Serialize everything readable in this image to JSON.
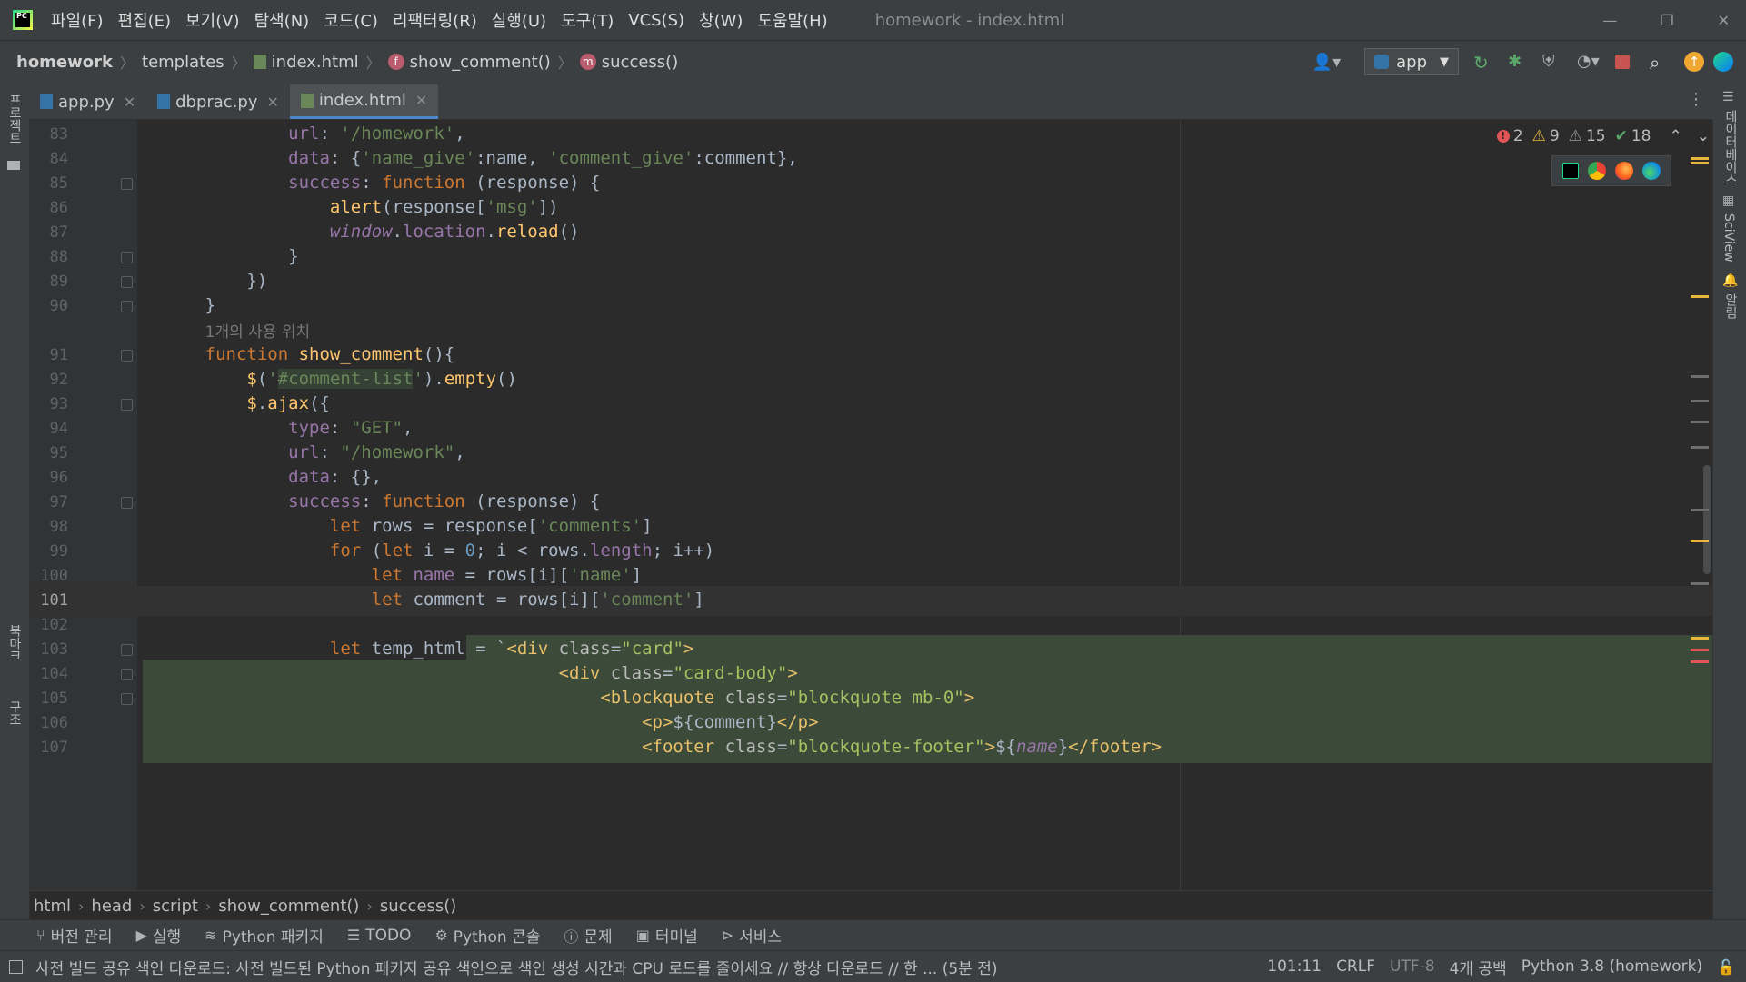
{
  "window": {
    "title": "homework - index.html"
  },
  "menu": [
    "파일(F)",
    "편집(E)",
    "보기(V)",
    "탐색(N)",
    "코드(C)",
    "리팩터링(R)",
    "실행(U)",
    "도구(T)",
    "VCS(S)",
    "창(W)",
    "도움말(H)"
  ],
  "breadcrumb": {
    "project": "homework",
    "folder": "templates",
    "file": "index.html",
    "func": "show_comment()",
    "method": "success()"
  },
  "run_config": "app",
  "tabs": [
    {
      "label": "app.py",
      "active": false
    },
    {
      "label": "dbprac.py",
      "active": false
    },
    {
      "label": "index.html",
      "active": true
    }
  ],
  "left_tools": {
    "project": "프로젝트",
    "bookmarks": "북마크",
    "structure": "구조"
  },
  "right_tools": {
    "database": "데이터베이스",
    "sciview": "SciView",
    "notifications": "알림"
  },
  "inspections": {
    "errors": "2",
    "warnings": "9",
    "weak_warnings": "15",
    "ok": "18"
  },
  "editor": {
    "usage_hint": "1개의 사용 위치",
    "lines": [
      "83",
      "84",
      "85",
      "86",
      "87",
      "88",
      "89",
      "90",
      "91",
      "92",
      "93",
      "94",
      "95",
      "96",
      "97",
      "98",
      "99",
      "100",
      "101",
      "102",
      "103",
      "104",
      "105",
      "106",
      "107"
    ]
  },
  "code_breadcrumbs": [
    "html",
    "head",
    "script",
    "show_comment()",
    "success()"
  ],
  "tool_windows": [
    "버전 관리",
    "실행",
    "Python 패키지",
    "TODO",
    "Python 콘솔",
    "문제",
    "터미널",
    "서비스"
  ],
  "status": {
    "message": "사전 빌드 공유 색인 다운로드: 사전 빌드된 Python 패키지 공유 색인으로 색인 생성 시간과 CPU 로드를 줄이세요 // 항상 다운로드 // 한 ... (5분 전)",
    "position": "101:11",
    "line_sep": "CRLF",
    "encoding": "UTF-8",
    "indent": "4개 공백",
    "interpreter": "Python 3.8 (homework)"
  },
  "colors": {
    "accent": "#4a88c7",
    "error": "#e05555",
    "warning": "#e5b73b"
  }
}
